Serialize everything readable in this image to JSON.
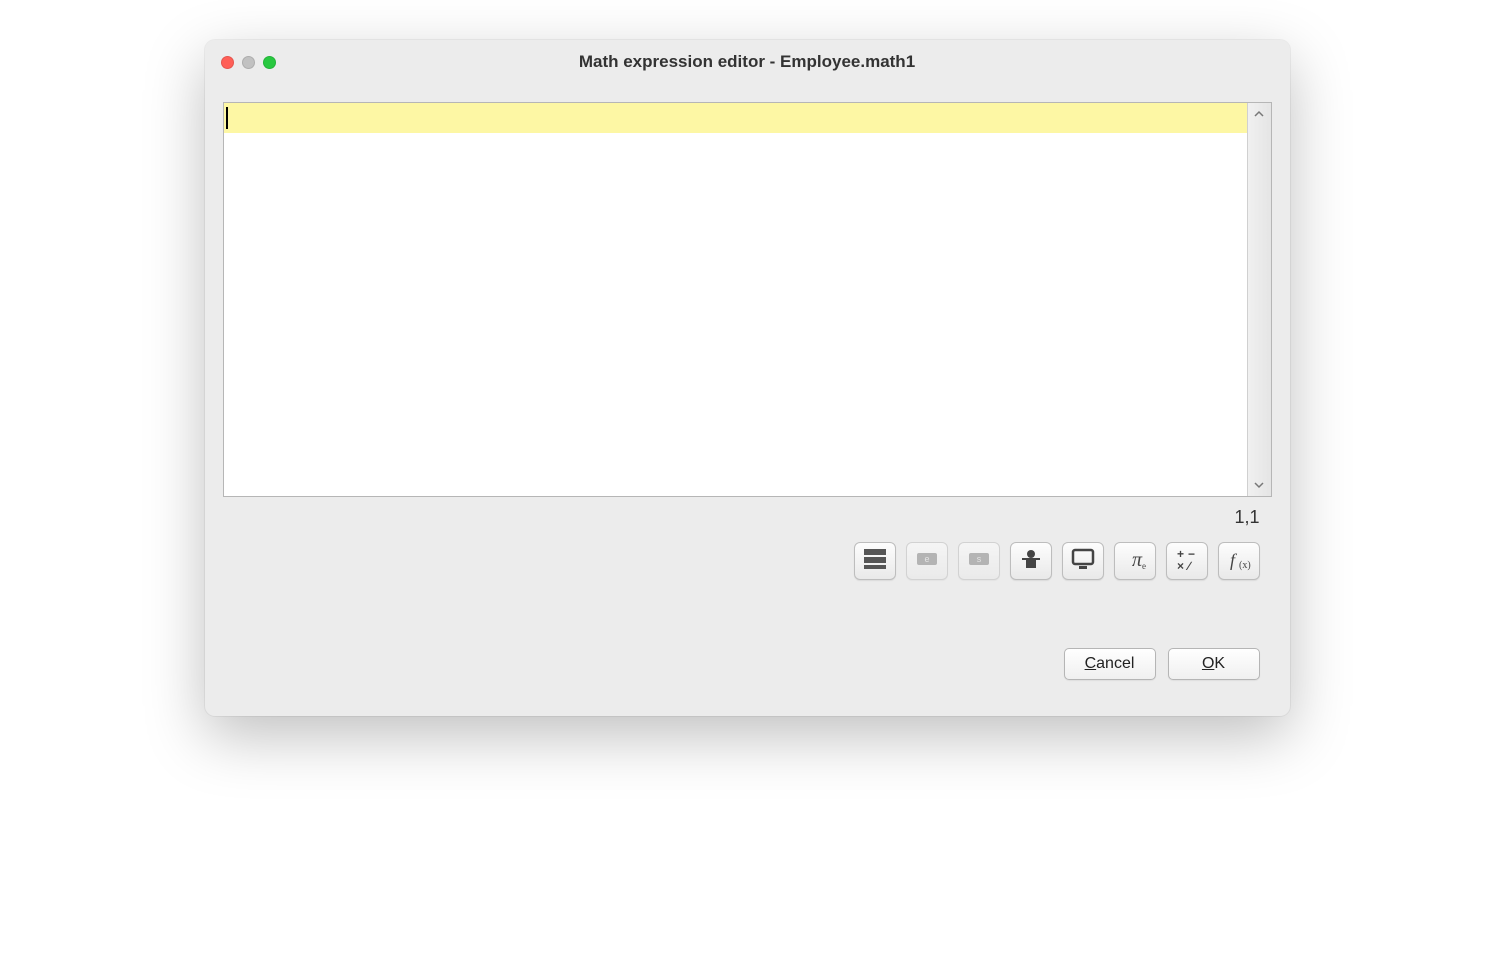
{
  "window": {
    "title": "Math expression editor - Employee.math1"
  },
  "editor": {
    "content": "",
    "cursorPosition": "1,1"
  },
  "toolbar": {
    "icons": {
      "block": "block-icon",
      "element": "element-icon",
      "set": "set-icon",
      "person": "person-icon",
      "monitor": "monitor-icon",
      "pi": "pi-icon",
      "operators": "operators-icon",
      "function": "function-icon"
    }
  },
  "buttons": {
    "cancel": "Cancel",
    "ok": "OK"
  }
}
